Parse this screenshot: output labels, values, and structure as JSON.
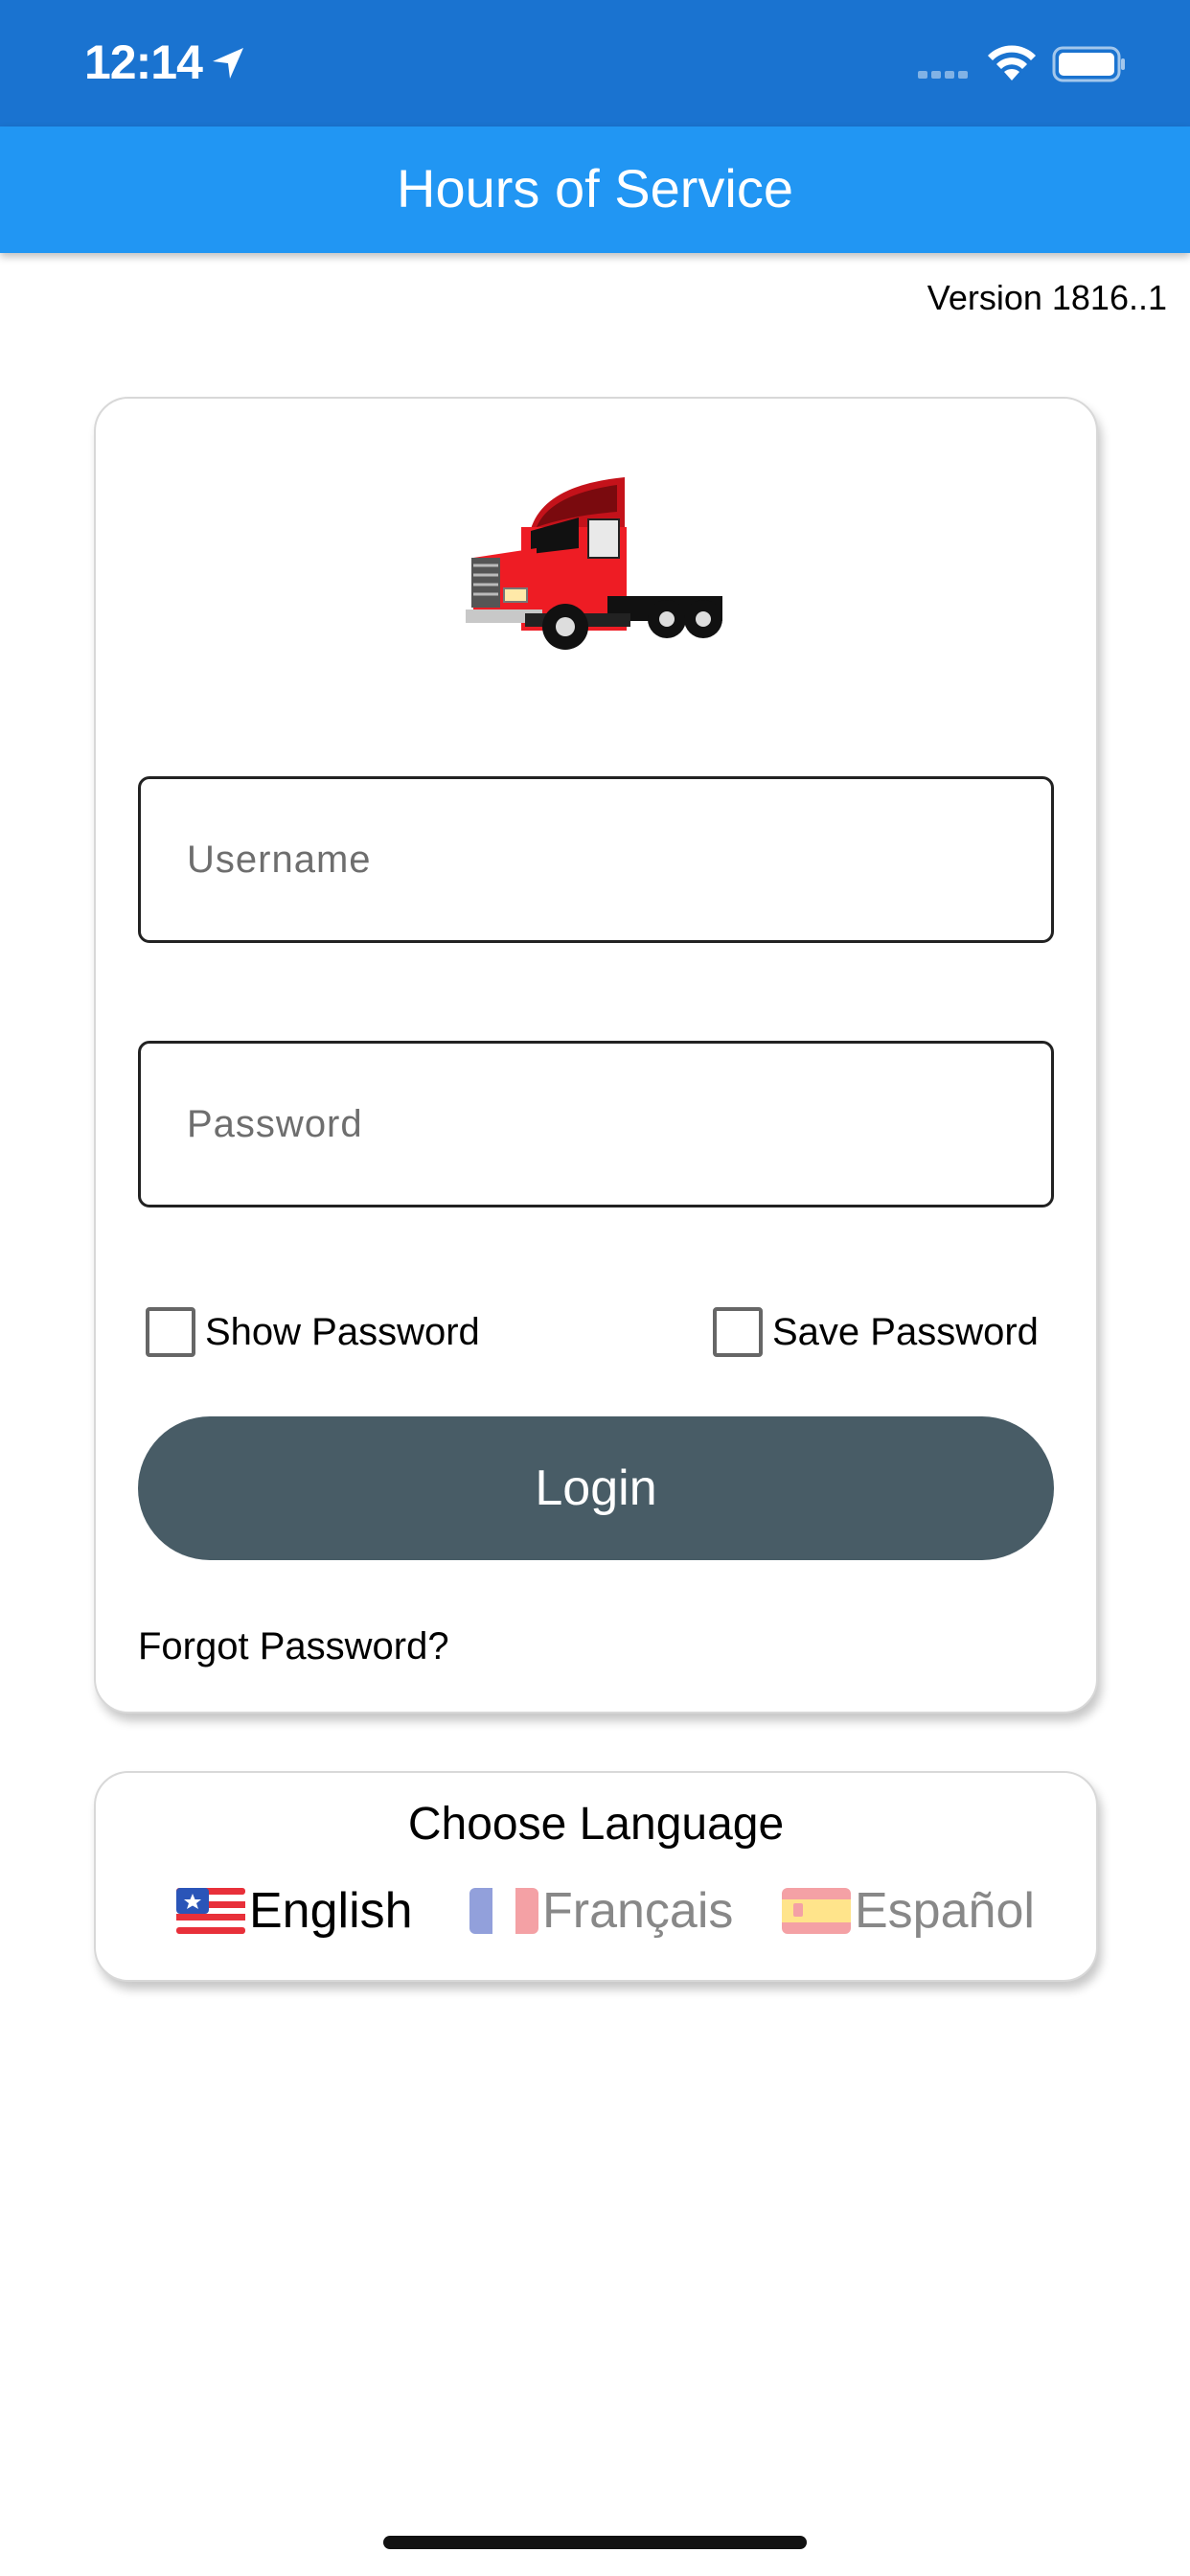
{
  "status_bar": {
    "time": "12:14",
    "icons": [
      "location-arrow-icon",
      "cellular-signal-icon",
      "wifi-icon",
      "battery-icon"
    ]
  },
  "app_bar": {
    "title": "Hours of Service",
    "background_color": "#2196f3"
  },
  "version_text": "Version 1816..1",
  "login_card": {
    "logo_icon": "truck-icon",
    "username": {
      "value": "",
      "placeholder": "Username"
    },
    "password": {
      "value": "",
      "placeholder": "Password"
    },
    "show_password": {
      "label": "Show Password",
      "checked": false
    },
    "save_password": {
      "label": "Save Password",
      "checked": false
    },
    "login_button": {
      "label": "Login",
      "color": "#485c66"
    },
    "forgot_password": "Forgot Password?"
  },
  "language_card": {
    "title": "Choose Language",
    "options": [
      {
        "label": "English",
        "icon": "us-flag-icon",
        "selected": true
      },
      {
        "label": "Français",
        "icon": "france-flag-icon",
        "selected": false
      },
      {
        "label": "Español",
        "icon": "spain-flag-icon",
        "selected": false
      }
    ]
  }
}
